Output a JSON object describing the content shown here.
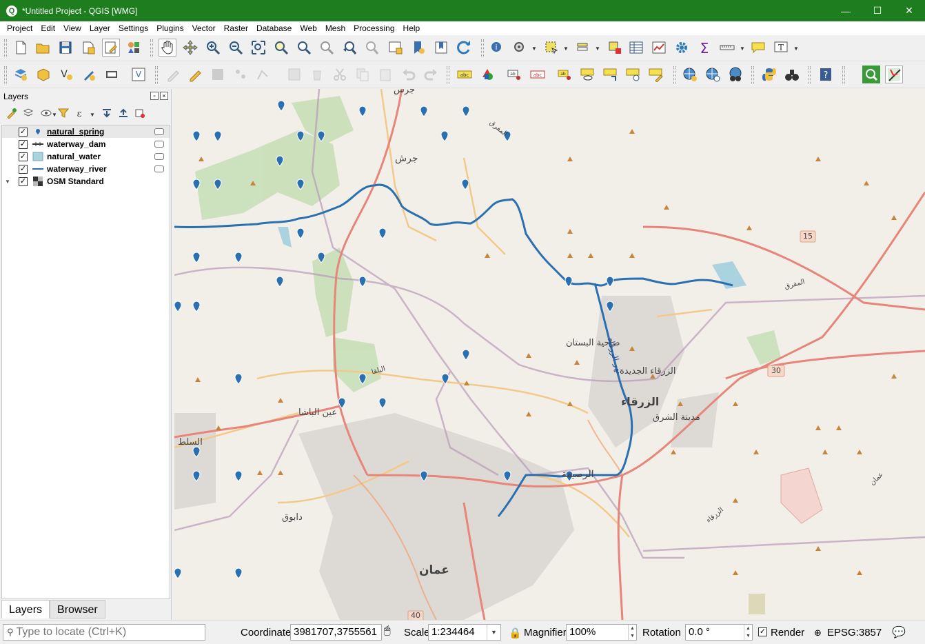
{
  "window": {
    "title": "*Untitled Project - QGIS [WMG]",
    "app_icon_letter": "Q",
    "minimize": "—",
    "maximize": "☐",
    "close": "✕"
  },
  "menu": [
    "Project",
    "Edit",
    "View",
    "Layer",
    "Settings",
    "Plugins",
    "Vector",
    "Raster",
    "Database",
    "Web",
    "Mesh",
    "Processing",
    "Help"
  ],
  "layers_panel": {
    "title": "Layers",
    "layers": [
      {
        "name": "natural_spring",
        "checked": "✓",
        "icon": "point-icon"
      },
      {
        "name": "waterway_dam",
        "checked": "✓",
        "icon": "line-icon"
      },
      {
        "name": "natural_water",
        "checked": "✓",
        "icon": "polygon-icon"
      },
      {
        "name": "waterway_river",
        "checked": "✓",
        "icon": "line-icon"
      },
      {
        "name": "OSM Standard",
        "checked": "✓",
        "icon": "raster-icon"
      }
    ],
    "tabs": [
      "Layers",
      "Browser"
    ]
  },
  "map": {
    "labels": {
      "jerash_top": "جرش",
      "jerash": "جرش",
      "mafraq_road": "المفرق",
      "dahiyat_bustan": "ضاحية البستان",
      "zarqa_new": "الزرقاء الجديدة",
      "zarqa": "الزرقاء",
      "madinat_sharq": "مدينة الشرق",
      "ain_basha": "عين الباشا",
      "salt": "السلط",
      "russeifa": "الرصيفة",
      "dabouq": "دابوق",
      "amman": "عمان",
      "balqa": "البلقا",
      "mafraq_right": "المفرق",
      "amman_road": "عمان",
      "zarqa_road": "الزرقاء",
      "river_label": "نهر الزرقاء",
      "shield_15": "15",
      "shield_30": "30",
      "shield_40": "40"
    }
  },
  "status": {
    "locator_placeholder": "Type to locate (Ctrl+K)",
    "coordinate_label": "Coordinate",
    "coordinate_value": "3981707,3755561",
    "scale_label": "Scale",
    "scale_value": "1:234464",
    "magnifier_label": "Magnifier",
    "magnifier_value": "100%",
    "rotation_label": "Rotation",
    "rotation_value": "0.0 °",
    "render_label": "Render",
    "render_checked": "✓",
    "crs": "EPSG:3857"
  },
  "colors": {
    "titlebar": "#1e7d1e",
    "river": "#2a6fb0",
    "road_primary": "#e8857a",
    "road_secondary": "#f0c07a",
    "boundary": "#b89bb8",
    "forest": "#add19e",
    "map_bg": "#f2efe9"
  }
}
